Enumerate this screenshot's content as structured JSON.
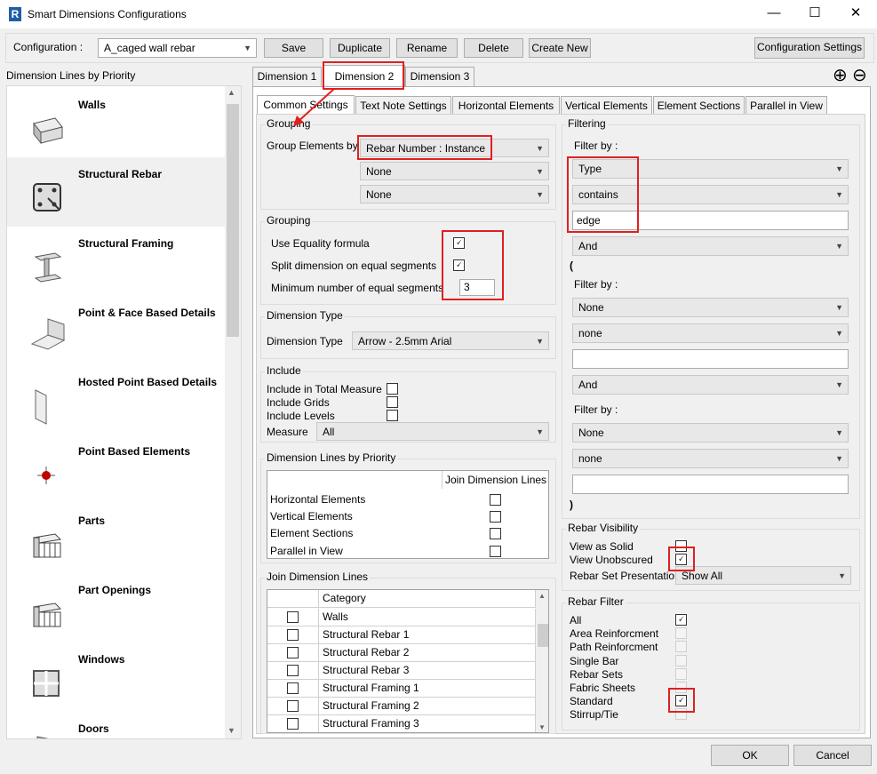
{
  "window": {
    "title": "Smart Dimensions Configurations",
    "logo": "R",
    "min": "—",
    "max": "☐",
    "close": "✕"
  },
  "toolbar": {
    "config_label": "Configuration :",
    "config_value": "A_caged wall rebar",
    "buttons": [
      "Save",
      "Duplicate",
      "Rename",
      "Delete",
      "Create New"
    ],
    "settings_button": "Configuration Settings"
  },
  "sidebar": {
    "title": "Dimension Lines by Priority",
    "items": [
      {
        "label": "Walls",
        "icon": "wall-icon"
      },
      {
        "label": "Structural Rebar",
        "icon": "rebar-icon"
      },
      {
        "label": "Structural Framing",
        "icon": "framing-icon"
      },
      {
        "label": "Point & Face Based Details",
        "icon": "face-detail-icon"
      },
      {
        "label": "Hosted Point Based Details",
        "icon": "hosted-detail-icon"
      },
      {
        "label": "Point Based Elements",
        "icon": "point-element-icon"
      },
      {
        "label": "Parts",
        "icon": "parts-icon"
      },
      {
        "label": "Part Openings",
        "icon": "part-openings-icon"
      },
      {
        "label": "Windows",
        "icon": "window-icon"
      },
      {
        "label": "Doors",
        "icon": "door-icon"
      }
    ]
  },
  "dim_tabs": [
    "Dimension 1",
    "Dimension 2",
    "Dimension 3"
  ],
  "add_icon": "⊕",
  "remove_icon": "⊖",
  "sub_tabs": [
    "Common Settings",
    "Text Note Settings",
    "Horizontal Elements",
    "Vertical Elements",
    "Element Sections",
    "Parallel in View"
  ],
  "grouping1": {
    "title": "Grouping",
    "label": "Group Elements by",
    "values": [
      "Rebar Number : Instance",
      "None",
      "None"
    ]
  },
  "grouping2": {
    "title": "Grouping",
    "equality_label": "Use Equality formula",
    "split_label": "Split dimension on equal segments",
    "min_label": "Minimum number of equal segments",
    "min_value": "3",
    "equality_checked": "🗸",
    "split_checked": "🗸"
  },
  "dimension_type": {
    "title": "Dimension Type",
    "label": "Dimension Type",
    "value": "Arrow - 2.5mm Arial"
  },
  "include": {
    "title": "Include",
    "total_label": "Include in Total Measure",
    "grids_label": "Include Grids",
    "levels_label": "Include Levels",
    "measure_label": "Measure",
    "measure_value": "All"
  },
  "priority": {
    "title": "Dimension Lines by Priority",
    "header": "Join Dimension Lines",
    "rows": [
      "Horizontal Elements",
      "Vertical Elements",
      "Element Sections",
      "Parallel in View"
    ]
  },
  "join": {
    "title": "Join Dimension Lines",
    "header": "Category",
    "rows": [
      "Walls",
      "Structural Rebar 1",
      "Structural Rebar 2",
      "Structural Rebar 3",
      "Structural Framing 1",
      "Structural Framing 2",
      "Structural Framing 3"
    ]
  },
  "filtering": {
    "title": "Filtering",
    "filter1": {
      "label": "Filter by :",
      "param": "Type",
      "op": "contains",
      "value": "edge"
    },
    "and1": "And",
    "paren_open": "(",
    "filter2": {
      "label": "Filter by :",
      "param": "None",
      "op": "none",
      "value": ""
    },
    "and2": "And",
    "filter3": {
      "label": "Filter by :",
      "param": "None",
      "op": "none",
      "value": ""
    },
    "paren_close": ")"
  },
  "rebar_visibility": {
    "title": "Rebar Visibility",
    "solid_label": "View as Solid",
    "unobscured_label": "View Unobscured",
    "unobscured_checked": "🗸",
    "presentation_label": "Rebar Set Presentation",
    "presentation_value": "Show All"
  },
  "rebar_filter": {
    "title": "Rebar Filter",
    "items": [
      "All",
      "Area Reinforcment",
      "Path Reinforcment",
      "Single Bar",
      "Rebar Sets",
      "Fabric Sheets",
      "Standard",
      "Stirrup/Tie"
    ],
    "all_checked": "🗸",
    "standard_checked": "🗸"
  },
  "footer": {
    "ok": "OK",
    "cancel": "Cancel"
  },
  "colors": {
    "highlight": "#e02020",
    "logo": "#1e5ea8"
  }
}
